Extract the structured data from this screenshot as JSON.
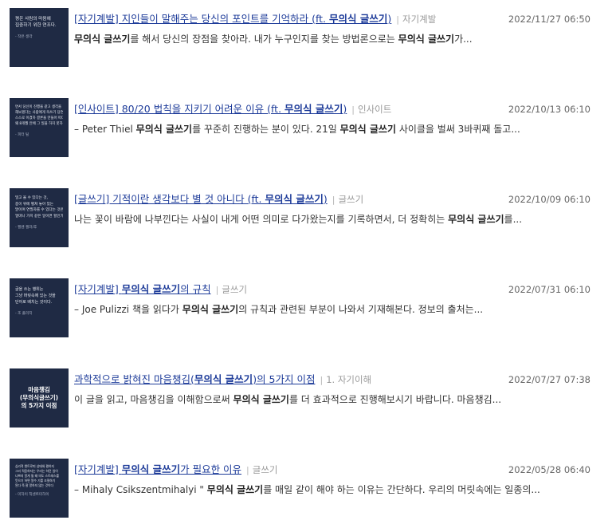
{
  "posts": [
    {
      "title_parts": [
        "[자기계발] 지인들이 말해주는 당신의 포인트를 기억하라 (ft. ",
        "무의식 글쓰기",
        ")"
      ],
      "category": "자기계발",
      "date": "2022/11/27 06:50",
      "excerpt_parts": [
        "",
        "무의식 글쓰기",
        "를 해서 당신의 장점을 찾아라. 내가 누구인지를 찾는 방법론으로는 ",
        "무의식 글쓰기",
        "가..."
      ],
      "thumb_lines": [
        "평온 사람의 마음에",
        "집중하기 위한 연조다."
      ],
      "thumb_author": "- 작은 생각"
    },
    {
      "title_parts": [
        "[인사이트] 80/20 법칙을 지키기 어려운 이유 (ft. ",
        "무의식 글쓰기",
        ")"
      ],
      "category": "인사이트",
      "date": "2022/10/13 06:10",
      "excerpt_parts": [
        "– Peter Thiel ",
        "무의식 글쓰기",
        "를 꾸준히 진행하는 분이 있다. 21일 ",
        "무의식 글쓰기",
        " 사이클을 벌써 3바퀴째 돌고..."
      ],
      "thumb_lines": [
        "면서 당신이 진행을 같고 생각을",
        "해보겠다는 사람에게 옥쓰기 당연한,",
        "스스로 이겼하 결론을 만들어 떠다,",
        "왜 8개월 안에 그 일을 하지 못하는가?"
      ],
      "thumb_author": "- 피터 틸"
    },
    {
      "title_parts": [
        "[글쓰기] 기적이란 생각보다 별 것 아니다 (ft. ",
        "무의식 글쓰기",
        ")"
      ],
      "category": "글쓰기",
      "date": "2022/10/09 06:10",
      "excerpt_parts": [
        "나는 꽃이 바람에 나부낀다는 사실이 내게 어떤 의미로 다가왔는지를 기록하면서, 더 정확히는 ",
        "무의식 글쓰기",
        "를..."
      ],
      "thumb_lines": [
        "밀고 올 수 있다는 것,",
        "종이 위에 펼쳐 놓아 있는",
        "말이며 연필자를 수 있다는 것은",
        "얼마나 가치 같은 일이면 할인가!"
      ],
      "thumb_author": "- 헬렌 켈러/후"
    },
    {
      "title_parts": [
        "[자기계발] ",
        "무의식 글쓰기",
        "의 규칙"
      ],
      "category": "글쓰기",
      "date": "2022/07/31 06:10",
      "excerpt_parts": [
        "– Joe Pulizzi 책을 읽다가 ",
        "무의식 글쓰기",
        "의 규칙과 관련된 부분이 나와서 기재해본다. 정보의 출처는..."
      ],
      "thumb_lines": [
        "글을 쓰는 행위는",
        "그냥 머릿속에 있는 것을",
        "단어로 배치는 것이다."
      ],
      "thumb_author": "- 조 풀리지"
    },
    {
      "title_parts": [
        "과학적으로 밝혀진 마음챙김(",
        "무의식 글쓰기",
        ")의 5가지 이점"
      ],
      "category": "1. 자기이해",
      "date": "2022/07/27 07:38",
      "excerpt_parts": [
        "이 글을 읽고, 마음챙김을 이해함으로써 ",
        "무의식 글쓰기",
        "를 더 효과적으로 진행해보시기 바랍니다. 마음챙김..."
      ],
      "thumb_lines": [
        "마음챙김",
        "(무의식글쓰기)",
        "의 5가지 이점"
      ],
      "thumb_author": ""
    },
    {
      "title_parts": [
        "[자기계발] ",
        "무의식 글쓰기",
        "가 필요한 이유"
      ],
      "category": "글쓰기",
      "date": "2022/05/28 06:40",
      "excerpt_parts": [
        "– Mihaly Csikszentmihalyi \" ",
        "무의식 글쓰기",
        "를 매일 같이 해야 하는 이유는 간단하다. 우리의 머릿속에는 일종의..."
      ],
      "thumb_lines": [
        "심리적 엔트로피 상태와 평하지",
        "그리 적응하자는 우리는 하던 일이",
        "나쁘지 알게 될 때 의도 스트레스를",
        "뜻으기 하면 알수 기를 조절하기",
        "된다 즉 잘 알하지 않는 것이다"
      ],
      "thumb_author": "- 미하이 칙센트미하이"
    }
  ],
  "colors": {
    "link": "#1d3b99",
    "thumb_bg": "#1f2a44",
    "category": "#9a9a9a",
    "date": "#666666"
  }
}
